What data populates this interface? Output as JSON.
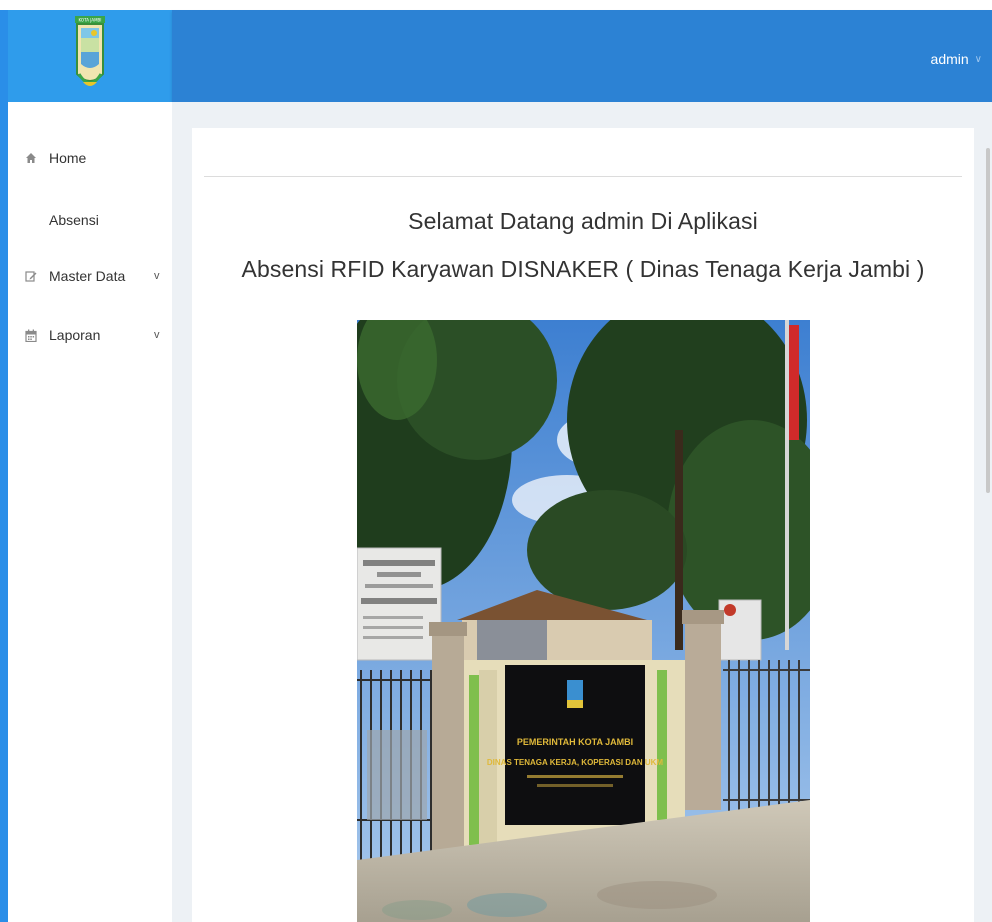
{
  "header": {
    "user_name": "admin",
    "user_caret": "∨",
    "logo_banner_text": "KOTA JAMBI"
  },
  "sidebar": {
    "items": [
      {
        "label": "Home",
        "icon": "home-icon",
        "has_submenu": false
      },
      {
        "label": "Absensi",
        "icon": "",
        "has_submenu": false
      },
      {
        "label": "Master Data",
        "icon": "edit-icon",
        "has_submenu": true,
        "chevron": "v"
      },
      {
        "label": "Laporan",
        "icon": "calendar-icon",
        "has_submenu": true,
        "chevron": "v"
      }
    ]
  },
  "main": {
    "welcome_line1": "Selamat Datang admin Di Aplikasi",
    "welcome_line2": "Absensi RFID Karyawan DISNAKER ( Dinas Tenaga Kerja Jambi )",
    "photo": {
      "sign_line1": "PEMERINTAH KOTA JAMBI",
      "sign_line2": "DINAS TENAGA KERJA, KOPERASI DAN UKM"
    }
  },
  "colors": {
    "topbar": "#2c82d4",
    "logo_box": "#2f9ceb",
    "frame": "#2a8ee8",
    "content_bg": "#edf1f5"
  }
}
